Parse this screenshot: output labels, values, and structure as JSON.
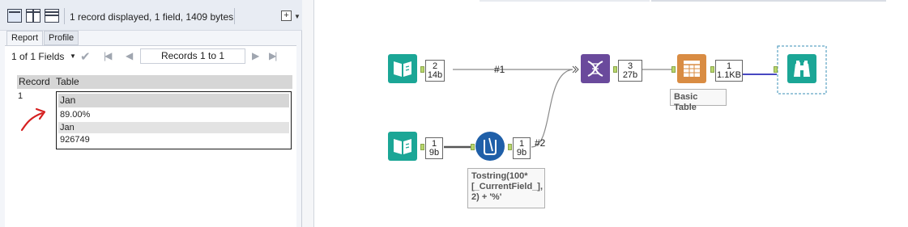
{
  "results": {
    "summary": "1 record displayed, 1 field, 1409 bytes",
    "tabs": [
      {
        "label": "Report"
      },
      {
        "label": "Profile"
      }
    ],
    "fields_select": "1 of 1 Fields",
    "records_label": "Records 1 to 1",
    "columns": [
      "Record",
      "Table"
    ],
    "rows": [
      {
        "num": "1",
        "table_cells": [
          "Jan",
          "89.00%",
          "Jan",
          "926749"
        ]
      }
    ],
    "icons": {
      "layout1": "layout-single-icon",
      "layout2": "layout-split-vertical-icon",
      "layout3": "layout-split-horizontal-icon",
      "add": "add-menu-icon",
      "check": "check-icon",
      "first": "first-record-icon",
      "prev": "previous-record-icon",
      "next": "next-record-icon",
      "last": "last-record-icon",
      "annotation": "red-arrow-annotation"
    }
  },
  "canvas": {
    "tools": [
      {
        "id": "input-1",
        "icon": "book-input-icon",
        "color": "#1ba696"
      },
      {
        "id": "input-2",
        "icon": "book-input-icon",
        "color": "#1ba696"
      },
      {
        "id": "multi-field-formula",
        "icon": "beaker-formula-icon",
        "color": "#1f5fa8"
      },
      {
        "id": "union",
        "icon": "dna-union-icon",
        "color": "#6a4a9c"
      },
      {
        "id": "basic-table",
        "icon": "table-icon",
        "color": "#d98c43"
      },
      {
        "id": "browse",
        "icon": "binoculars-icon",
        "color": "#1ba696"
      }
    ],
    "counts": {
      "input1": [
        "2",
        "14b"
      ],
      "input2": [
        "1",
        "9b"
      ],
      "formula": [
        "1",
        "9b"
      ],
      "union": [
        "3",
        "27b"
      ],
      "table": [
        "1",
        "1.1KB"
      ]
    },
    "wire_labels": {
      "w1": "#1",
      "w2": "#2"
    },
    "annotations": {
      "basic_table": "Basic Table",
      "formula": [
        "Tostring(100*",
        "[_CurrentField_],",
        "2) + '%'"
      ]
    },
    "colors": {
      "wire": "#8a8a8a",
      "output_wire": "#2e2eb8",
      "anchor": "#b8d66c"
    }
  }
}
